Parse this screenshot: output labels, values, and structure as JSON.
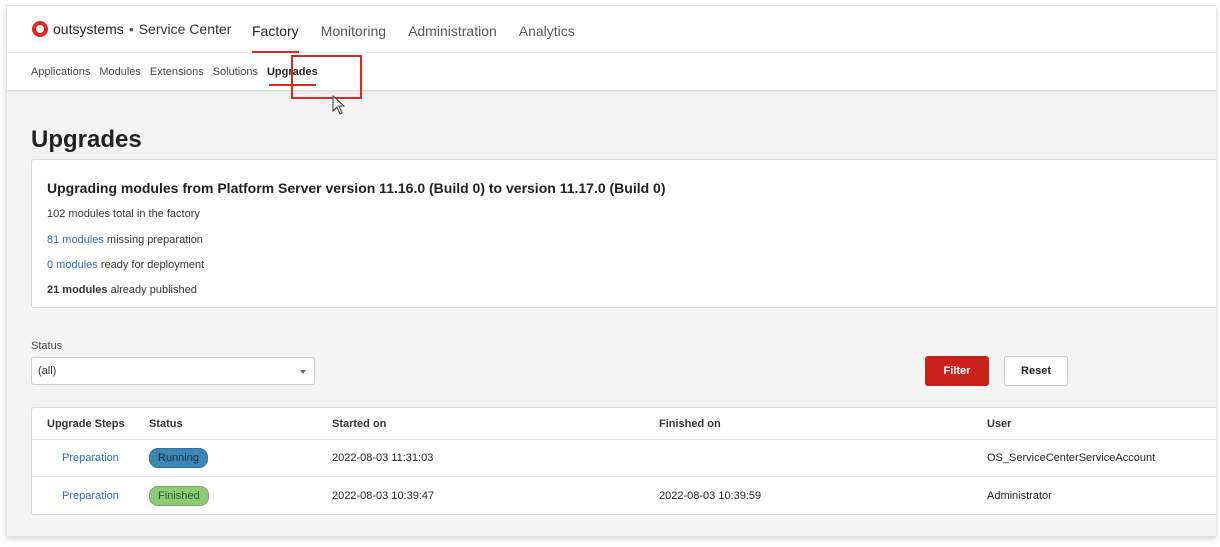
{
  "brand": {
    "name": "outsystems",
    "separator": "•",
    "product": "Service Center"
  },
  "top_nav": [
    {
      "label": "Factory",
      "active": true
    },
    {
      "label": "Monitoring",
      "active": false
    },
    {
      "label": "Administration",
      "active": false
    },
    {
      "label": "Analytics",
      "active": false
    }
  ],
  "sub_nav": [
    {
      "label": "Applications",
      "active": false
    },
    {
      "label": "Modules",
      "active": false
    },
    {
      "label": "Extensions",
      "active": false
    },
    {
      "label": "Solutions",
      "active": false
    },
    {
      "label": "Upgrades",
      "active": true
    }
  ],
  "page": {
    "title": "Upgrades"
  },
  "summary": {
    "heading": "Upgrading modules from Platform Server version 11.16.0 (Build 0) to version 11.17.0 (Build 0)",
    "total": "102 modules total in the factory",
    "missing_link": "81 modules",
    "missing_text": " missing preparation",
    "ready_link": "0 modules",
    "ready_text": " ready for deployment",
    "published_bold": "21 modules",
    "published_text": " already published"
  },
  "filter": {
    "status_label": "Status",
    "status_value": "(all)",
    "filter_button": "Filter",
    "reset_button": "Reset"
  },
  "table": {
    "headers": [
      "Upgrade Steps",
      "Status",
      "Started on",
      "Finished on",
      "User"
    ],
    "rows": [
      {
        "step": "Preparation",
        "status": "Running",
        "started": "2022-08-03 11:31:03",
        "finished": "",
        "user": "OS_ServiceCenterServiceAccount"
      },
      {
        "step": "Preparation",
        "status": "Finished",
        "started": "2022-08-03 10:39:47",
        "finished": "2022-08-03 10:39:59",
        "user": "Administrator"
      }
    ]
  },
  "colors": {
    "accent": "#e1261c",
    "link": "#2f6db5",
    "running": "#3d86b6",
    "finished": "#8ccc79"
  }
}
